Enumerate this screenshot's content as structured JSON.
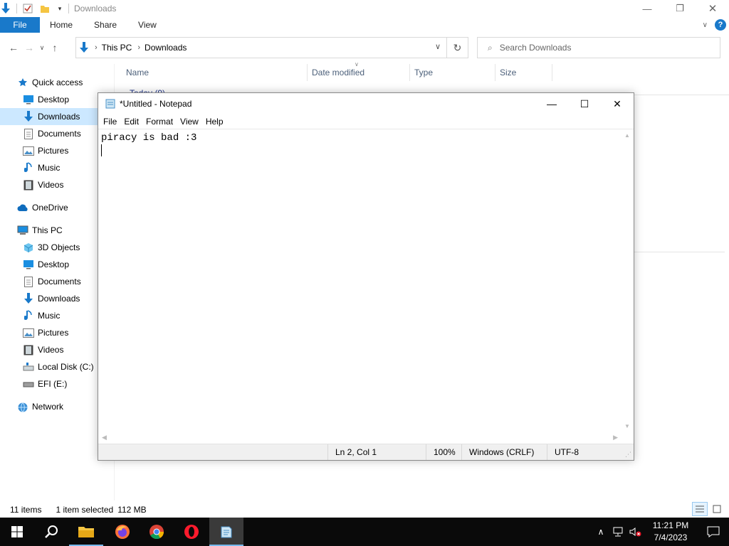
{
  "explorer": {
    "title": "Downloads",
    "ribbon": {
      "file": "File",
      "home": "Home",
      "share": "Share",
      "view": "View"
    },
    "address": {
      "root": "This PC",
      "current": "Downloads"
    },
    "search_placeholder": "Search Downloads",
    "columns": {
      "name": "Name",
      "date": "Date modified",
      "type": "Type",
      "size": "Size"
    },
    "group_header": "Today (9)",
    "sidebar": {
      "quick_access": "Quick access",
      "quick": [
        {
          "label": "Desktop",
          "icon": "desktop-icon"
        },
        {
          "label": "Downloads",
          "icon": "downloads-icon",
          "selected": true
        },
        {
          "label": "Documents",
          "icon": "documents-icon"
        },
        {
          "label": "Pictures",
          "icon": "pictures-icon"
        },
        {
          "label": "Music",
          "icon": "music-icon"
        },
        {
          "label": "Videos",
          "icon": "videos-icon"
        }
      ],
      "onedrive": "OneDrive",
      "this_pc": "This PC",
      "pc": [
        {
          "label": "3D Objects",
          "icon": "3d-objects-icon"
        },
        {
          "label": "Desktop",
          "icon": "desktop-icon"
        },
        {
          "label": "Documents",
          "icon": "documents-icon"
        },
        {
          "label": "Downloads",
          "icon": "downloads-icon"
        },
        {
          "label": "Music",
          "icon": "music-icon"
        },
        {
          "label": "Pictures",
          "icon": "pictures-icon"
        },
        {
          "label": "Videos",
          "icon": "videos-icon"
        },
        {
          "label": "Local Disk (C:)",
          "icon": "disk-icon"
        },
        {
          "label": "EFI (E:)",
          "icon": "drive-icon"
        }
      ],
      "network": "Network"
    },
    "status": {
      "items": "11 items",
      "selected": "1 item selected",
      "size": "112 MB"
    }
  },
  "notepad": {
    "title": "*Untitled - Notepad",
    "menu": [
      "File",
      "Edit",
      "Format",
      "View",
      "Help"
    ],
    "text": "piracy is bad :3",
    "status": {
      "position": "Ln 2, Col 1",
      "zoom": "100%",
      "eol": "Windows (CRLF)",
      "encoding": "UTF-8"
    }
  },
  "taskbar": {
    "apps": [
      "start-icon",
      "search-icon",
      "file-explorer-icon",
      "firefox-icon",
      "chrome-icon",
      "opera-icon",
      "notepad-icon"
    ],
    "time": "11:21 PM",
    "date": "7/4/2023"
  },
  "colors": {
    "accent": "#1979ca",
    "selection": "#cce8ff",
    "taskbar": "#0a0a0a"
  }
}
